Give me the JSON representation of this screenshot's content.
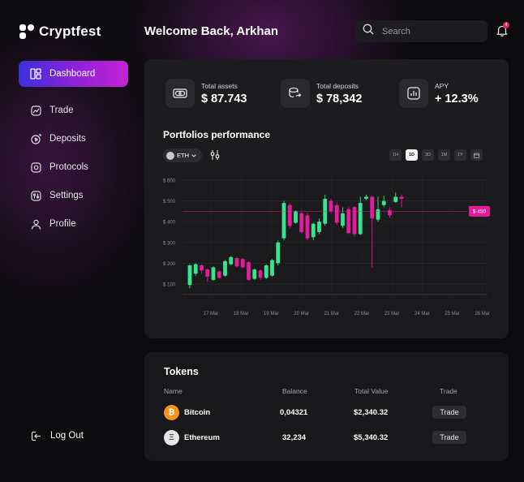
{
  "app": {
    "name": "Cryptfest"
  },
  "header": {
    "welcome": "Welcome Back, Arkhan",
    "search_placeholder": "Search",
    "notification_count": "4"
  },
  "sidebar": {
    "items": [
      {
        "label": "Dashboard",
        "icon": "dashboard-icon",
        "active": true
      },
      {
        "label": "Trade",
        "icon": "trade-chart-icon"
      },
      {
        "label": "Deposits",
        "icon": "deposit-coin-icon"
      },
      {
        "label": "Protocols",
        "icon": "protocol-icon"
      },
      {
        "label": "Settings",
        "icon": "settings-icon"
      },
      {
        "label": "Profile",
        "icon": "user-icon"
      }
    ],
    "logout": "Log Out"
  },
  "stats": [
    {
      "label": "Total assets",
      "value": "$ 87.743",
      "icon": "wallet-icon"
    },
    {
      "label": "Total deposits",
      "value": "$ 78,342",
      "icon": "deposit-icon"
    },
    {
      "label": "APY",
      "value": "+ 12.3%",
      "icon": "bar-chart-icon"
    }
  ],
  "performance": {
    "title": "Portfolios performance",
    "asset": "ETH",
    "ranges": [
      "1H",
      "1D",
      "3D",
      "1M",
      "1Y"
    ],
    "active_range": "1D",
    "price_tag": "$ 450"
  },
  "colors": {
    "up": "#37e58f",
    "down": "#e41c9b",
    "accent": "#9a21d8"
  },
  "chart_data": {
    "type": "candlestick",
    "y_ticks": [
      "$ 100",
      "$ 200",
      "$ 300",
      "$ 400",
      "$ 500",
      "$ 600"
    ],
    "ylim": [
      50,
      620
    ],
    "x_ticks": [
      "17 Mar",
      "18 Mar",
      "19 Mar",
      "20 Mar",
      "21 Mar",
      "22 Mar",
      "23 Mar",
      "24 Mar",
      "25 Mar",
      "26 Mar"
    ],
    "current_price": 450,
    "candles": [
      {
        "o": 95,
        "c": 190,
        "h": 195,
        "l": 80
      },
      {
        "o": 150,
        "c": 195,
        "h": 200,
        "l": 140
      },
      {
        "o": 190,
        "c": 165,
        "h": 195,
        "l": 150
      },
      {
        "o": 170,
        "c": 135,
        "h": 175,
        "l": 110
      },
      {
        "o": 120,
        "c": 180,
        "h": 185,
        "l": 115
      },
      {
        "o": 160,
        "c": 130,
        "h": 165,
        "l": 125
      },
      {
        "o": 140,
        "c": 210,
        "h": 215,
        "l": 135
      },
      {
        "o": 195,
        "c": 230,
        "h": 235,
        "l": 190
      },
      {
        "o": 225,
        "c": 185,
        "h": 230,
        "l": 180
      },
      {
        "o": 220,
        "c": 180,
        "h": 225,
        "l": 175
      },
      {
        "o": 205,
        "c": 120,
        "h": 210,
        "l": 115
      },
      {
        "o": 125,
        "c": 170,
        "h": 175,
        "l": 120
      },
      {
        "o": 165,
        "c": 130,
        "h": 170,
        "l": 120
      },
      {
        "o": 130,
        "c": 190,
        "h": 195,
        "l": 125
      },
      {
        "o": 140,
        "c": 215,
        "h": 220,
        "l": 135
      },
      {
        "o": 200,
        "c": 300,
        "h": 310,
        "l": 190
      },
      {
        "o": 320,
        "c": 490,
        "h": 500,
        "l": 310
      },
      {
        "o": 480,
        "c": 380,
        "h": 490,
        "l": 370
      },
      {
        "o": 395,
        "c": 450,
        "h": 455,
        "l": 390
      },
      {
        "o": 440,
        "c": 350,
        "h": 450,
        "l": 345
      },
      {
        "o": 430,
        "c": 320,
        "h": 440,
        "l": 310
      },
      {
        "o": 325,
        "c": 390,
        "h": 395,
        "l": 310
      },
      {
        "o": 350,
        "c": 400,
        "h": 415,
        "l": 340
      },
      {
        "o": 390,
        "c": 510,
        "h": 530,
        "l": 380
      },
      {
        "o": 500,
        "c": 450,
        "h": 510,
        "l": 440
      },
      {
        "o": 480,
        "c": 395,
        "h": 490,
        "l": 385
      },
      {
        "o": 380,
        "c": 440,
        "h": 470,
        "l": 370
      },
      {
        "o": 460,
        "c": 345,
        "h": 470,
        "l": 340
      },
      {
        "o": 470,
        "c": 340,
        "h": 475,
        "l": 330
      },
      {
        "o": 340,
        "c": 490,
        "h": 520,
        "l": 335
      },
      {
        "o": 510,
        "c": 520,
        "h": 530,
        "l": 505
      },
      {
        "o": 520,
        "c": 415,
        "h": 525,
        "l": 180
      },
      {
        "o": 410,
        "c": 460,
        "h": 520,
        "l": 400
      },
      {
        "o": 480,
        "c": 500,
        "h": 525,
        "l": 470
      },
      {
        "o": 455,
        "c": 430,
        "h": 470,
        "l": 420
      },
      {
        "o": 495,
        "c": 520,
        "h": 540,
        "l": 490
      },
      {
        "o": 520,
        "c": 510,
        "h": 530,
        "l": 470
      }
    ]
  },
  "tokens": {
    "title": "Tokens",
    "columns": [
      "Name",
      "Balance",
      "Total Value",
      "Trade"
    ],
    "rows": [
      {
        "name": "Bitcoin",
        "symbol": "₿",
        "balance": "0,04321",
        "value": "$2,340.32",
        "action": "Trade"
      },
      {
        "name": "Ethereum",
        "symbol": "Ξ",
        "balance": "32,234",
        "value": "$5,340.32",
        "action": "Trade"
      }
    ]
  }
}
